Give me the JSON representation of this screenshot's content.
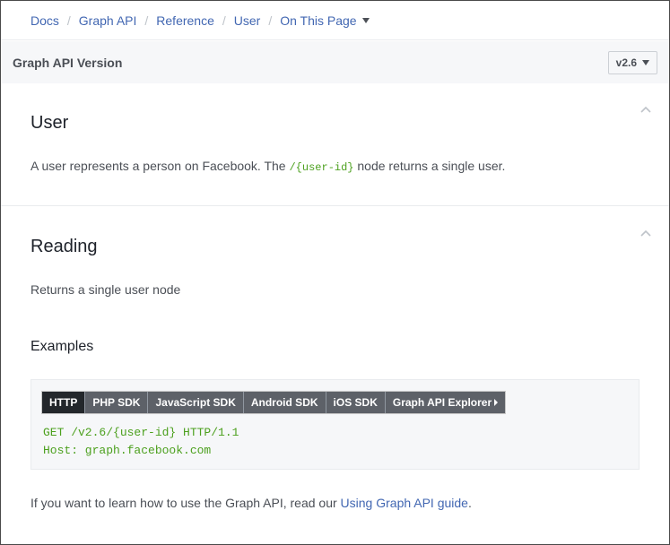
{
  "breadcrumb": {
    "items": [
      "Docs",
      "Graph API",
      "Reference",
      "User"
    ],
    "separator": "/",
    "on_this_page": "On This Page"
  },
  "version_bar": {
    "title": "Graph API Version",
    "selected_version": "v2.6"
  },
  "user_section": {
    "title": "User",
    "description_before": "A user represents a person on Facebook. The ",
    "code": "/{user-id}",
    "description_after": " node returns a single user."
  },
  "reading_section": {
    "title": "Reading",
    "description": "Returns a single user node",
    "examples_title": "Examples",
    "tabs": [
      "HTTP",
      "PHP SDK",
      "JavaScript SDK",
      "Android SDK",
      "iOS SDK",
      "Graph API Explorer"
    ],
    "active_tab": "HTTP",
    "code_line_1": "GET /v2.6/{user-id} HTTP/1.1",
    "code_line_2": "Host: graph.facebook.com",
    "footer_before": "If you want to learn how to use the Graph API, read our ",
    "footer_link": "Using Graph API guide",
    "footer_after": "."
  },
  "colors": {
    "link": "#4267b2",
    "code_green": "#4ca01e",
    "active_tab": "#23272b",
    "tab": "#5d6168"
  }
}
